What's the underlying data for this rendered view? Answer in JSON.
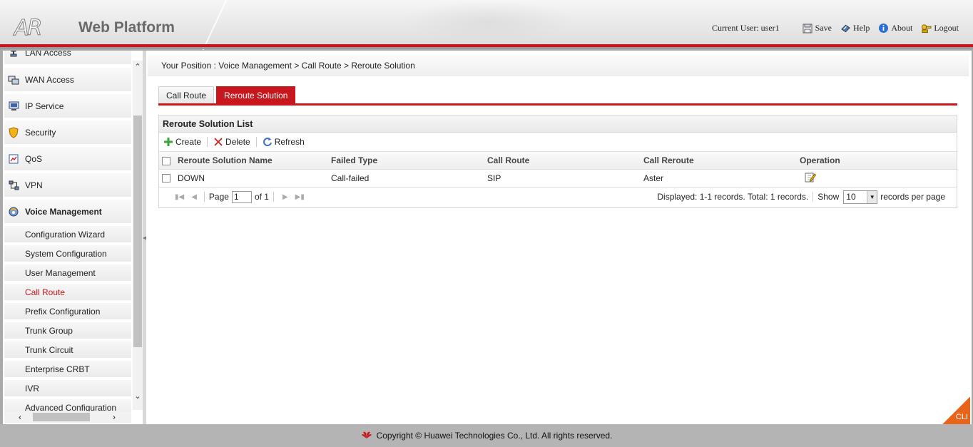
{
  "header": {
    "logo_mark": "AR",
    "logo_text": "Web Platform",
    "current_user": "Current User: user1",
    "links": [
      {
        "label": "Save",
        "icon": "save-icon"
      },
      {
        "label": "Help",
        "icon": "help-icon"
      },
      {
        "label": "About",
        "icon": "about-icon"
      },
      {
        "label": "Logout",
        "icon": "logout-icon"
      }
    ]
  },
  "sidebar": {
    "items": [
      {
        "label": "LAN Access",
        "icon": "lan-icon"
      },
      {
        "label": "WAN Access",
        "icon": "wan-icon"
      },
      {
        "label": "IP Service",
        "icon": "ip-service-icon"
      },
      {
        "label": "Security",
        "icon": "shield-icon"
      },
      {
        "label": "QoS",
        "icon": "qos-icon"
      },
      {
        "label": "VPN",
        "icon": "vpn-icon"
      },
      {
        "label": "Voice Management",
        "icon": "voice-icon"
      }
    ],
    "sub_items": [
      {
        "label": "Configuration Wizard"
      },
      {
        "label": "System Configuration"
      },
      {
        "label": "User Management"
      },
      {
        "label": "Call Route"
      },
      {
        "label": "Prefix Configuration"
      },
      {
        "label": "Trunk Group"
      },
      {
        "label": "Trunk Circuit"
      },
      {
        "label": "Enterprise CRBT"
      },
      {
        "label": "IVR"
      },
      {
        "label": "Advanced Configuration"
      }
    ],
    "active_sub": "Call Route"
  },
  "main": {
    "breadcrumb": "Your Position :  Voice Management > Call Route > Reroute Solution",
    "tabs": [
      {
        "label": "Call Route",
        "active": false
      },
      {
        "label": "Reroute Solution",
        "active": true
      }
    ],
    "panel_title": "Reroute Solution List",
    "toolbar": {
      "create": "Create",
      "delete": "Delete",
      "refresh": "Refresh"
    },
    "table": {
      "columns": [
        "Reroute Solution Name",
        "Failed Type",
        "Call Route",
        "Call Reroute",
        "Operation"
      ],
      "rows": [
        {
          "name": "DOWN",
          "failed_type": "Call-failed",
          "call_route": "SIP",
          "call_reroute": "Aster"
        }
      ]
    },
    "pager": {
      "page_label": "Page",
      "page_value": "1",
      "of_label": "of 1",
      "displayed": "Displayed: 1-1 records. Total: 1 records.",
      "show_label": "Show",
      "show_value": "10",
      "per_page_label": "records per page"
    },
    "cli_label": "CLI"
  },
  "footer": {
    "copyright": "Copyright © Huawei Technologies Co., Ltd. All rights reserved."
  },
  "colors": {
    "accent": "#c8161d",
    "cli": "#e8641a"
  }
}
